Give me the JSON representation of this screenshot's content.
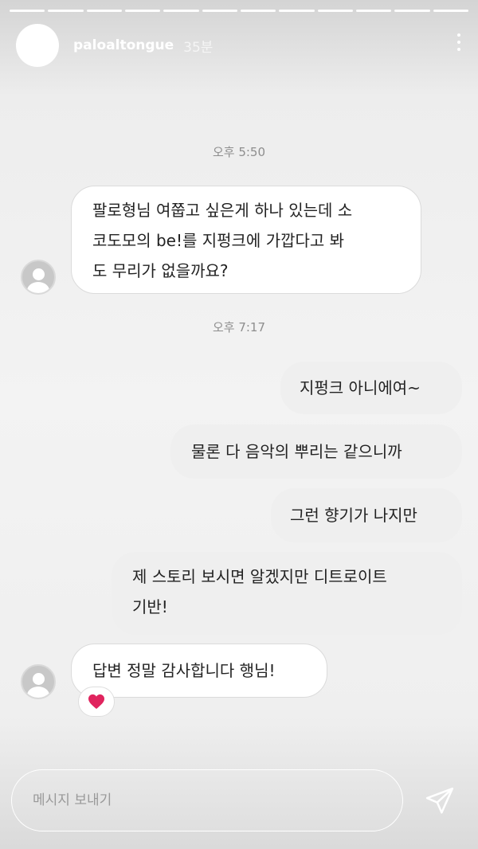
{
  "header": {
    "username": "paloaltongue",
    "time_ago": "35분",
    "avatar": "white-circle",
    "menu_icon": "more-vertical-icon"
  },
  "progress_segments": 12,
  "messages": {
    "t1": "오후 5:50",
    "in1": [
      "팔로형님 여쭙고 싶은게 하나 있는데 소",
      "코도모의 be!를 지펑크에 가깝다고 봐",
      "도 무리가 없을까요?"
    ],
    "t2": "오후 7:17",
    "out1": "지펑크 아니에여~",
    "out2": "물론 다 음악의 뿌리는 같으니까",
    "out3": "그런 향기가 나지만",
    "out4": [
      "제 스토리 보시면 알겠지만 디트로이트",
      "기반!"
    ],
    "in2": "답변 정말 감사합니다 행님!",
    "reaction": "heart-icon"
  },
  "composer": {
    "placeholder": "메시지 보내기",
    "send_icon": "send-icon"
  },
  "colors": {
    "bubble_in": "#ffffff",
    "bubble_out": "#efefef",
    "timestamp": "#8e8e8e",
    "heart": "#e0245e"
  }
}
